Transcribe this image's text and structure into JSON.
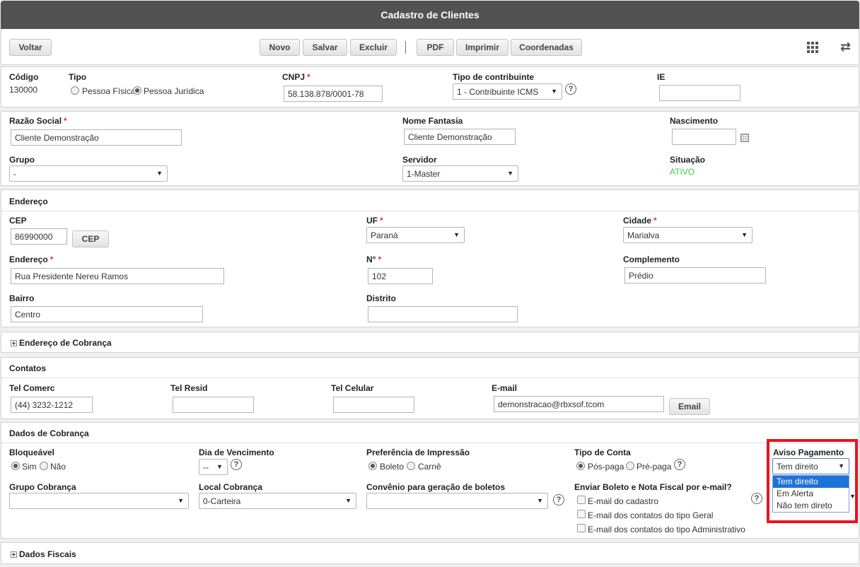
{
  "window": {
    "title": "Cadastro de Clientes"
  },
  "toolbar": {
    "back": "Voltar",
    "new": "Novo",
    "save": "Salvar",
    "delete": "Excluir",
    "pdf": "PDF",
    "print": "Imprimir",
    "coords": "Coordenadas"
  },
  "identification": {
    "codigo_label": "Código",
    "codigo_value": "130000",
    "tipo_label": "Tipo",
    "tipo_fisica": "Pessoa Física",
    "tipo_juridica": "Pessoa Jurídica",
    "cnpj_label": "CNPJ",
    "cnpj_value": "58.138.878/0001-78",
    "contribuinte_label": "Tipo de contribuinte",
    "contribuinte_value": "1 - Contribuinte ICMS",
    "ie_label": "IE",
    "ie_value": ""
  },
  "general": {
    "razao_label": "Razão Social",
    "razao_value": "Cliente Demonstração",
    "fantasia_label": "Nome Fantasia",
    "fantasia_value": "Cliente Demonstração",
    "nascimento_label": "Nascimento",
    "nascimento_value": "",
    "grupo_label": "Grupo",
    "grupo_value": "-",
    "servidor_label": "Servidor",
    "servidor_value": "1-Master",
    "situacao_label": "Situação",
    "situacao_value": "ATIVO",
    "situacao_color": "#3ecf3e"
  },
  "endereco": {
    "title": "Endereço",
    "cep_label": "CEP",
    "cep_value": "86990000",
    "cep_button": "CEP",
    "uf_label": "UF",
    "uf_value": "Paraná",
    "cidade_label": "Cidade",
    "cidade_value": "Marialva",
    "endereco_label": "Endereço",
    "endereco_value": "Rua Presidente Nereu Ramos",
    "numero_label": "N°",
    "numero_value": "102",
    "complemento_label": "Complemento",
    "complemento_value": "Prédio",
    "bairro_label": "Bairro",
    "bairro_value": "Centro",
    "distrito_label": "Distrito",
    "distrito_value": ""
  },
  "cobranca_endereco": {
    "title": "Endereço de Cobrança"
  },
  "contatos": {
    "title": "Contatos",
    "tel_comerc_label": "Tel Comerc",
    "tel_comerc_value": "(44) 3232-1212",
    "tel_resid_label": "Tel Resid",
    "tel_resid_value": "",
    "tel_celular_label": "Tel Celular",
    "tel_celular_value": "",
    "email_label": "E-mail",
    "email_value": "demonstracao@rbxsof.tcom",
    "email_button": "Email"
  },
  "dados_cobranca": {
    "title": "Dados de Cobrança",
    "bloqueavel_label": "Bloqueável",
    "sim": "Sim",
    "nao": "Não",
    "vencimento_label": "Dia de Vencimento",
    "vencimento_value": "--",
    "preferencia_label": "Preferência de Impressão",
    "boleto": "Boleto",
    "carne": "Carnê",
    "tipo_conta_label": "Tipo de Conta",
    "pos_paga": "Pós-paga",
    "pre_paga": "Pré-paga",
    "aviso_label": "Aviso Pagamento",
    "aviso_value": "Tem direito",
    "aviso_options": [
      "Tem direito",
      "Em Alerta",
      "Não tem direto"
    ],
    "grupo_cobranca_label": "Grupo Cobrança",
    "grupo_cobranca_value": "",
    "local_cobranca_label": "Local Cobrança",
    "local_cobranca_value": "0-Carteira",
    "convenio_label": "Convênio para geração de boletos",
    "convenio_value": "",
    "enviar_label": "Enviar Boleto e Nota Fiscal por e-mail?",
    "email_cadastro": "E-mail do cadastro",
    "email_geral": "E-mail dos contatos do tipo Geral",
    "email_admin": "E-mail dos contatos do tipo Administrativo"
  },
  "dados_fiscais": {
    "title": "Dados Fiscais"
  },
  "colors": {
    "highlight": "#e8141e",
    "required": "#e23333",
    "title_bar": "#525252"
  }
}
